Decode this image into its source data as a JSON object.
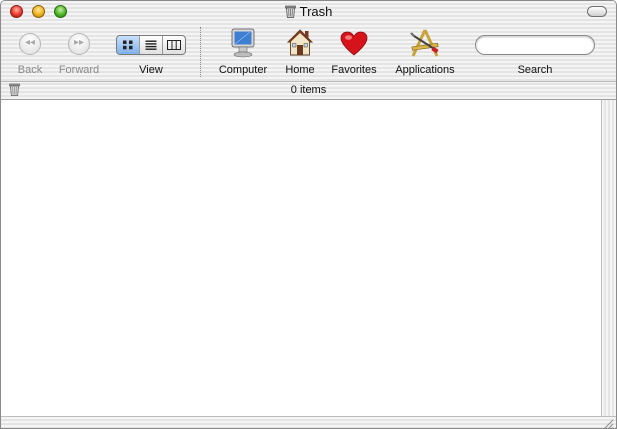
{
  "window": {
    "title": "Trash",
    "title_icon": "trash-icon"
  },
  "toolbar": {
    "back_label": "Back",
    "forward_label": "Forward",
    "view_label": "View",
    "view_modes": [
      "icon-view",
      "list-view",
      "column-view"
    ],
    "view_selected": "icon-view",
    "items": [
      {
        "label": "Computer",
        "icon": "computer-icon"
      },
      {
        "label": "Home",
        "icon": "home-icon"
      },
      {
        "label": "Favorites",
        "icon": "heart-icon"
      },
      {
        "label": "Applications",
        "icon": "applications-icon"
      }
    ],
    "search_label": "Search",
    "search_value": ""
  },
  "status": {
    "item_count": "0 items",
    "icon": "trash-icon"
  },
  "colors": {
    "close": "#e8392b",
    "minimize": "#f0b21a",
    "zoom": "#4cb524",
    "view_active": "#7fb1ea",
    "heart": "#d6121a"
  }
}
